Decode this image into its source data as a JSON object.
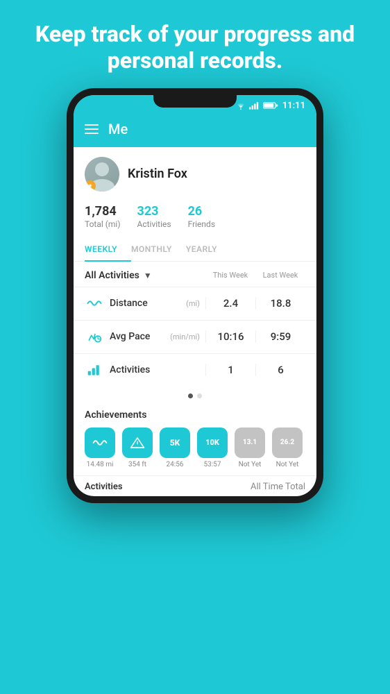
{
  "page": {
    "background_color": "#1EC8D4",
    "headline": "Keep track of your progress and personal records."
  },
  "status_bar": {
    "time": "11:11",
    "icons": [
      "wifi",
      "signal",
      "battery"
    ]
  },
  "header": {
    "title": "Me"
  },
  "profile": {
    "name": "Kristin Fox",
    "avatar_alt": "Profile photo"
  },
  "stats": [
    {
      "value": "1,784",
      "label": "Total (mi)",
      "highlight": false
    },
    {
      "value": "323",
      "label": "Activities",
      "highlight": true
    },
    {
      "value": "26",
      "label": "Friends",
      "highlight": true
    }
  ],
  "tabs": [
    {
      "label": "WEEKLY",
      "active": true
    },
    {
      "label": "MONTHLY",
      "active": false
    },
    {
      "label": "YEARLY",
      "active": false
    }
  ],
  "activity_filter": {
    "label": "All Activities",
    "this_week_col": "This Week",
    "last_week_col": "Last Week"
  },
  "metrics": [
    {
      "icon": "distance-icon",
      "name": "Distance",
      "unit": "(mi)",
      "this_week": "2.4",
      "last_week": "18.8"
    },
    {
      "icon": "pace-icon",
      "name": "Avg Pace",
      "unit": "(min/mi)",
      "this_week": "10:16",
      "last_week": "9:59"
    },
    {
      "icon": "activities-icon",
      "name": "Activities",
      "unit": "",
      "this_week": "1",
      "last_week": "6"
    }
  ],
  "pagination": {
    "current": 0,
    "total": 2
  },
  "achievements": {
    "title": "Achievements",
    "items": [
      {
        "label": "14.48 mi",
        "badge_text": "~",
        "color": "teal",
        "icon": "distance-badge"
      },
      {
        "label": "354 ft",
        "badge_text": "▲",
        "color": "teal",
        "icon": "elevation-badge"
      },
      {
        "label": "24:56",
        "badge_text": "5K",
        "color": "teal",
        "icon": "5k-badge"
      },
      {
        "label": "53:57",
        "badge_text": "10K",
        "color": "teal",
        "icon": "10k-badge"
      },
      {
        "label": "Not Yet",
        "badge_text": "13.1",
        "color": "gray",
        "icon": "half-marathon-badge"
      },
      {
        "label": "Not Yet",
        "badge_text": "26.2",
        "color": "gray",
        "icon": "marathon-badge"
      }
    ]
  },
  "bottom_bar": {
    "left": "Activities",
    "right": "All Time Total"
  }
}
